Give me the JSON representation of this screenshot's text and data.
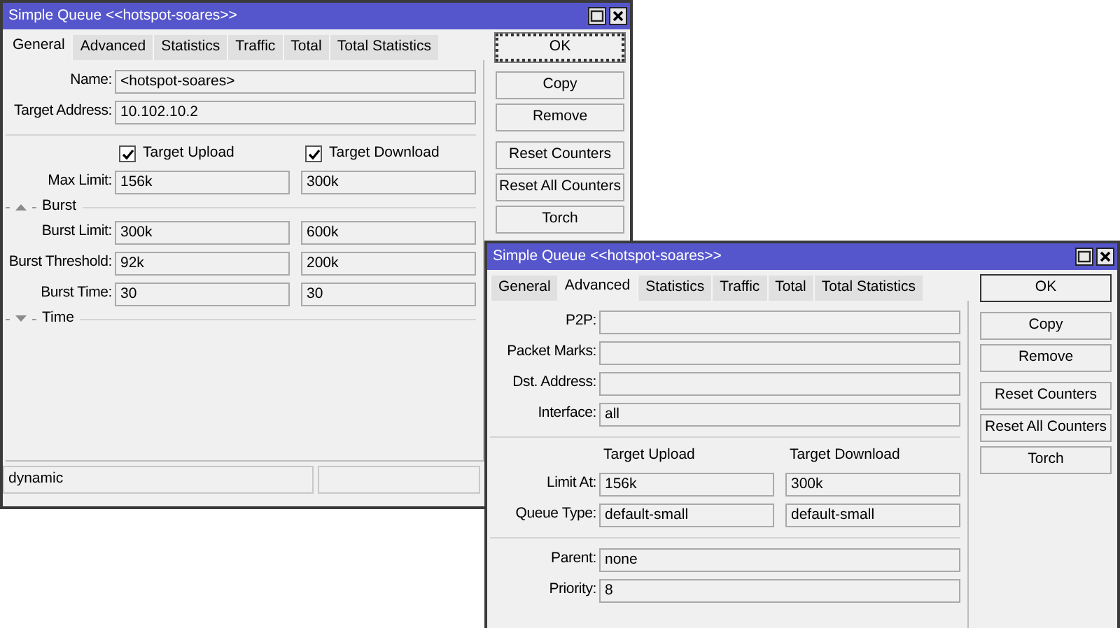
{
  "windows": [
    {
      "title": "Simple Queue <<hotspot-soares>>",
      "tabs": [
        {
          "label": "General",
          "selected": true
        },
        {
          "label": "Advanced",
          "selected": false
        },
        {
          "label": "Statistics",
          "selected": false
        },
        {
          "label": "Traffic",
          "selected": false
        },
        {
          "label": "Total",
          "selected": false
        },
        {
          "label": "Total Statistics",
          "selected": false
        }
      ],
      "rows": [
        {
          "kind": "field",
          "label": "Name:",
          "values": [
            "<hotspot-soares>"
          ]
        },
        {
          "kind": "field",
          "label": "Target Address:",
          "values": [
            "10.102.10.2"
          ]
        },
        {
          "kind": "divider"
        },
        {
          "kind": "checks",
          "items": [
            {
              "label": "Target Upload",
              "checked": true
            },
            {
              "label": "Target Download",
              "checked": true
            }
          ]
        },
        {
          "kind": "pair",
          "label": "Max Limit:",
          "values": [
            "156k",
            "300k"
          ]
        },
        {
          "kind": "group",
          "label": "Burst",
          "expanded": true
        },
        {
          "kind": "pair",
          "label": "Burst Limit:",
          "values": [
            "300k",
            "600k"
          ]
        },
        {
          "kind": "pair",
          "label": "Burst Threshold:",
          "values": [
            "92k",
            "200k"
          ]
        },
        {
          "kind": "pair",
          "label": "Burst Time:",
          "values": [
            "30",
            "30"
          ]
        },
        {
          "kind": "group",
          "label": "Time",
          "expanded": false
        }
      ],
      "button_groups": [
        [
          {
            "label": "OK",
            "focused": true
          }
        ],
        [
          {
            "label": "Copy",
            "focused": false
          },
          {
            "label": "Remove",
            "focused": false
          }
        ],
        [
          {
            "label": "Reset Counters",
            "focused": false
          },
          {
            "label": "Reset All Counters",
            "focused": false
          },
          {
            "label": "Torch",
            "focused": false
          }
        ]
      ],
      "status_bar": {
        "text": "dynamic"
      }
    },
    {
      "title": "Simple Queue <<hotspot-soares>>",
      "tabs": [
        {
          "label": "General",
          "selected": false
        },
        {
          "label": "Advanced",
          "selected": true
        },
        {
          "label": "Statistics",
          "selected": false
        },
        {
          "label": "Traffic",
          "selected": false
        },
        {
          "label": "Total",
          "selected": false
        },
        {
          "label": "Total Statistics",
          "selected": false
        }
      ],
      "rows": [
        {
          "kind": "field",
          "label": "P2P:"
        },
        {
          "kind": "field",
          "label": "Packet Marks:"
        },
        {
          "kind": "field",
          "label": "Dst. Address:"
        },
        {
          "kind": "field",
          "label": "Interface:",
          "values": [
            "all"
          ]
        },
        {
          "kind": "divider"
        },
        {
          "kind": "columns",
          "labels": [
            "Target Upload",
            "Target Download"
          ]
        },
        {
          "kind": "pair",
          "label": "Limit At:",
          "values": [
            "156k",
            "300k"
          ]
        },
        {
          "kind": "pair",
          "label": "Queue Type:",
          "values": [
            "default-small",
            "default-small"
          ]
        },
        {
          "kind": "divider"
        },
        {
          "kind": "field",
          "label": "Parent:",
          "values": [
            "none"
          ]
        },
        {
          "kind": "field",
          "label": "Priority:",
          "values": [
            "8"
          ]
        }
      ],
      "button_groups": [
        [
          {
            "label": "OK",
            "focused": false
          }
        ],
        [
          {
            "label": "Copy",
            "focused": false
          },
          {
            "label": "Remove",
            "focused": false
          }
        ],
        [
          {
            "label": "Reset Counters",
            "focused": false
          },
          {
            "label": "Reset All Counters",
            "focused": false
          },
          {
            "label": "Torch",
            "focused": false
          }
        ]
      ]
    }
  ]
}
